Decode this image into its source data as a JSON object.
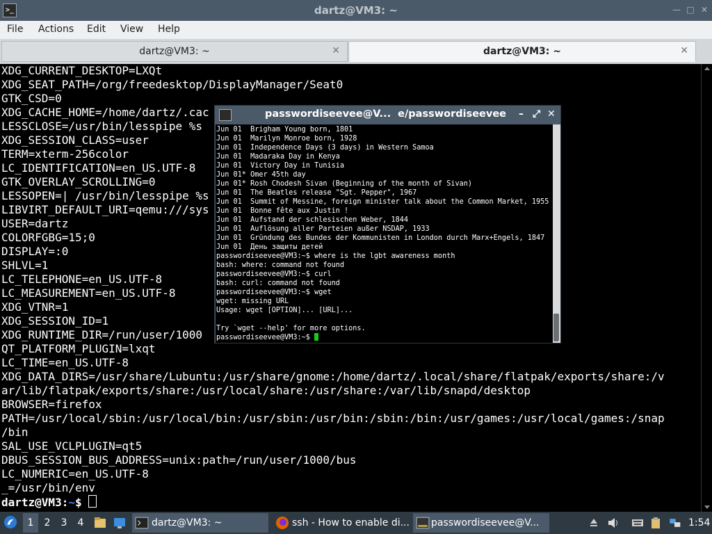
{
  "window": {
    "title": "dartz@VM3: ~",
    "controls": [
      "minimize-icon",
      "maximize-icon",
      "close-icon"
    ]
  },
  "menu": {
    "file": "File",
    "actions": "Actions",
    "edit": "Edit",
    "view": "View",
    "help": "Help"
  },
  "tabs": [
    {
      "label": "dartz@VM3: ~",
      "active": false
    },
    {
      "label": "dartz@VM3: ~",
      "active": true
    }
  ],
  "terminal": {
    "lines": [
      "XDG_CURRENT_DESKTOP=LXQt",
      "XDG_SEAT_PATH=/org/freedesktop/DisplayManager/Seat0",
      "GTK_CSD=0",
      "XDG_CACHE_HOME=/home/dartz/.cac",
      "LESSCLOSE=/usr/bin/lesspipe %s",
      "XDG_SESSION_CLASS=user",
      "TERM=xterm-256color",
      "LC_IDENTIFICATION=en_US.UTF-8",
      "GTK_OVERLAY_SCROLLING=0",
      "LESSOPEN=| /usr/bin/lesspipe %s",
      "LIBVIRT_DEFAULT_URI=qemu:///sys",
      "USER=dartz",
      "COLORFGBG=15;0",
      "DISPLAY=:0",
      "SHLVL=1",
      "LC_TELEPHONE=en_US.UTF-8",
      "LC_MEASUREMENT=en_US.UTF-8",
      "XDG_VTNR=1",
      "XDG_SESSION_ID=1",
      "XDG_RUNTIME_DIR=/run/user/1000",
      "QT_PLATFORM_PLUGIN=lxqt",
      "LC_TIME=en_US.UTF-8",
      "XDG_DATA_DIRS=/usr/share/Lubuntu:/usr/share/gnome:/home/dartz/.local/share/flatpak/exports/share:/v",
      "ar/lib/flatpak/exports/share:/usr/local/share:/usr/share:/var/lib/snapd/desktop",
      "BROWSER=firefox",
      "PATH=/usr/local/sbin:/usr/local/bin:/usr/sbin:/usr/bin:/sbin:/bin:/usr/games:/usr/local/games:/snap",
      "/bin",
      "SAL_USE_VCLPLUGIN=qt5",
      "DBUS_SESSION_BUS_ADDRESS=unix:path=/run/user/1000/bus",
      "LC_NUMERIC=en_US.UTF-8",
      "_=/usr/bin/env"
    ],
    "prompt_user": "dartz@VM3",
    "prompt_sep": ":",
    "prompt_path": "~",
    "prompt_end": "$ "
  },
  "xterm": {
    "title": "passwordiseevee@V...  e/passwordiseevee",
    "lines": [
      "Jun 01  Brigham Young born, 1801",
      "Jun 01  Marilyn Monroe born, 1928",
      "Jun 01  Independence Days (3 days) in Western Samoa",
      "Jun 01  Madaraka Day in Kenya",
      "Jun 01  Victory Day in Tunisia",
      "Jun 01* Omer 45th day",
      "Jun 01* Rosh Chodesh Sivan (Beginning of the month of Sivan)",
      "Jun 01  The Beatles release \"Sgt. Pepper\", 1967",
      "Jun 01  Summit of Messine, foreign minister talk about the Common Market, 1955",
      "Jun 01  Bonne fête aux Justin !",
      "Jun 01  Aufstand der schlesischen Weber, 1844",
      "Jun 01  Auflösung aller Parteien außer NSDAP, 1933",
      "Jun 01  Gründung des Bundes der Kommunisten in London durch Marx+Engels, 1847",
      "Jun 01  День защиты детей",
      "passwordiseevee@VM3:~$ where is the lgbt awareness month",
      "bash: where: command not found",
      "passwordiseevee@VM3:~$ curl",
      "bash: curl: command not found",
      "passwordiseevee@VM3:~$ wget",
      "wget: missing URL",
      "Usage: wget [OPTION]... [URL]...",
      "",
      "Try `wget --help' for more options.",
      "passwordiseevee@VM3:~$ "
    ]
  },
  "taskbar": {
    "desktops": [
      "1",
      "2",
      "3",
      "4"
    ],
    "tasks": [
      {
        "label": "dartz@VM3: ~",
        "icon": "terminal-icon"
      },
      {
        "label": "ssh - How to enable di...",
        "icon": "firefox-icon"
      },
      {
        "label": "passwordiseevee@V...",
        "icon": "xterm-icon"
      }
    ],
    "clock": "1:54"
  },
  "colors": {
    "titlebar": "#4b5a69",
    "prompt_path": "#4f80ff",
    "cursor_green": "#19c919",
    "taskbar": "#2f3942"
  }
}
